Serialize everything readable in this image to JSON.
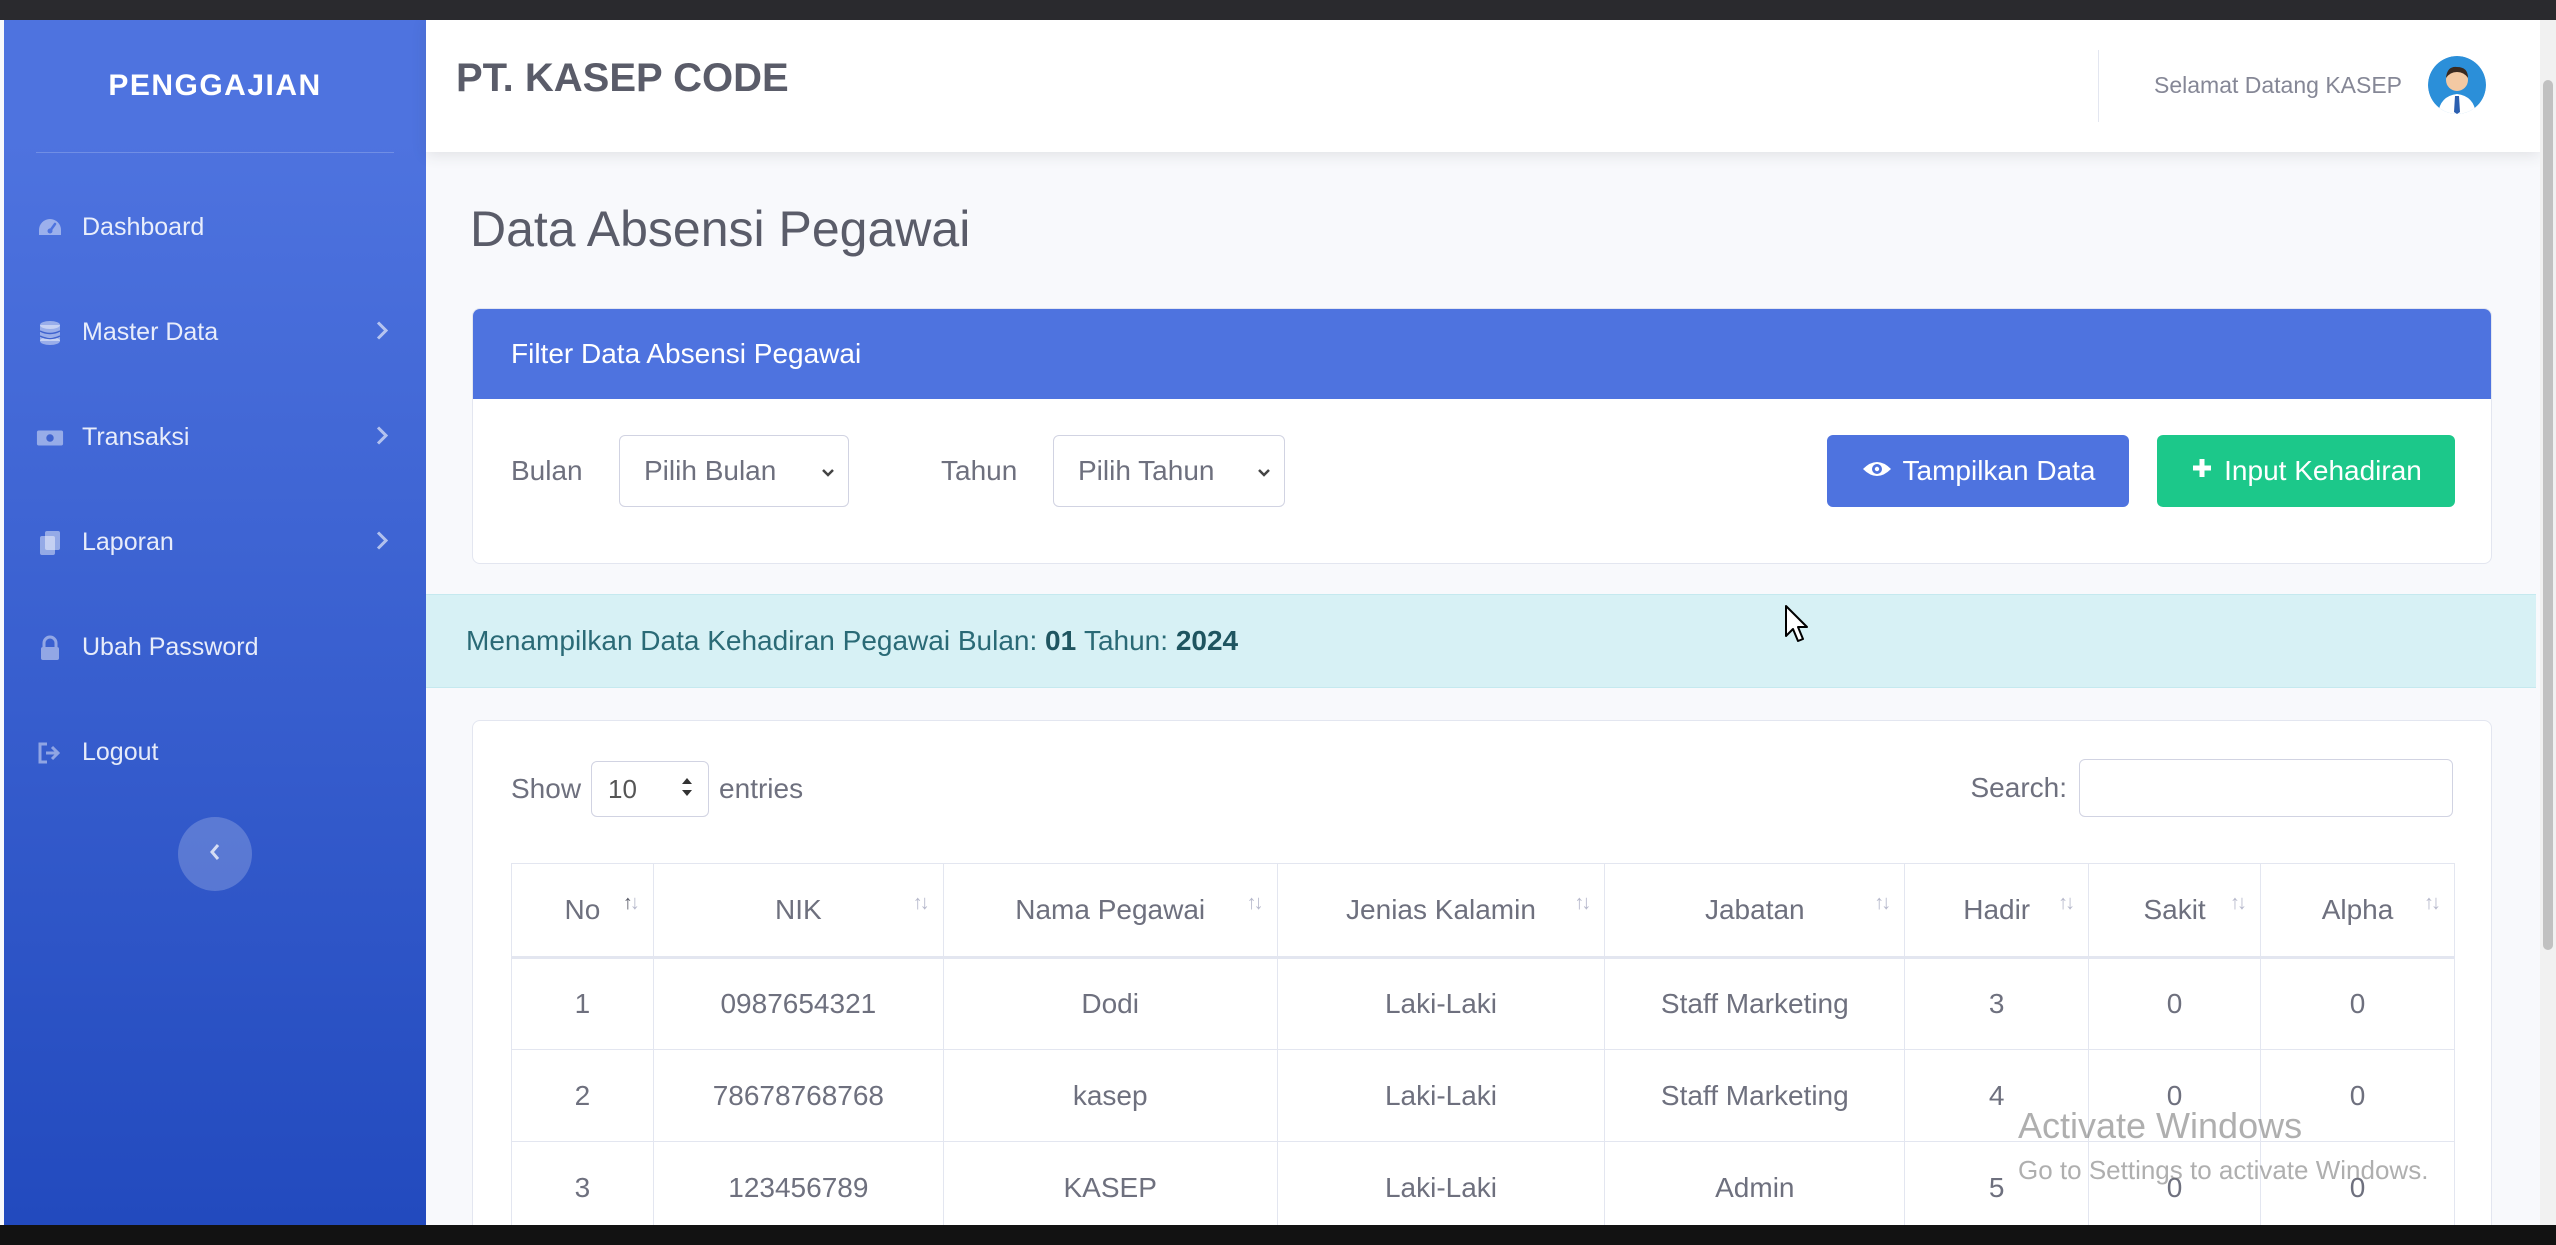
{
  "sidebar": {
    "brand": "PENGGAJIAN",
    "items": [
      {
        "label": "Dashboard",
        "icon": "tachometer-icon"
      },
      {
        "label": "Master Data",
        "icon": "database-icon"
      },
      {
        "label": "Transaksi",
        "icon": "money-icon"
      },
      {
        "label": "Laporan",
        "icon": "copy-icon"
      },
      {
        "label": "Ubah Password",
        "icon": "lock-icon"
      },
      {
        "label": "Logout",
        "icon": "sign-out-icon"
      }
    ]
  },
  "topbar": {
    "company": "PT. KASEP CODE",
    "welcome": "Selamat Datang KASEP"
  },
  "page": {
    "title": "Data Absensi Pegawai"
  },
  "filter": {
    "header": "Filter Data Absensi Pegawai",
    "bulan_label": "Bulan",
    "bulan_value": "Pilih Bulan",
    "tahun_label": "Tahun",
    "tahun_value": "Pilih Tahun",
    "tampilkan_label": "Tampilkan Data",
    "input_label": "Input Kehadiran"
  },
  "alert": {
    "prefix": "Menampilkan Data Kehadiran Pegawai Bulan:",
    "bulan": "01",
    "tahun_prefix": "Tahun:",
    "tahun": "2024"
  },
  "table": {
    "show_label": "Show",
    "entries_value": "10",
    "entries_label": "entries",
    "search_label": "Search:",
    "columns": [
      "No",
      "NIK",
      "Nama Pegawai",
      "Jenias Kalamin",
      "Jabatan",
      "Hadir",
      "Sakit",
      "Alpha"
    ],
    "rows": [
      [
        "1",
        "0987654321",
        "Dodi",
        "Laki-Laki",
        "Staff Marketing",
        "3",
        "0",
        "0"
      ],
      [
        "2",
        "78678768768",
        "kasep",
        "Laki-Laki",
        "Staff Marketing",
        "4",
        "0",
        "0"
      ],
      [
        "3",
        "123456789",
        "KASEP",
        "Laki-Laki",
        "Admin",
        "5",
        "0",
        "0"
      ]
    ]
  },
  "watermark": {
    "line1": "Activate Windows",
    "line2": "Go to Settings to activate Windows."
  },
  "colors": {
    "primary": "#4e73df",
    "success": "#1cc88a",
    "info_bg": "#d7f1f5"
  }
}
